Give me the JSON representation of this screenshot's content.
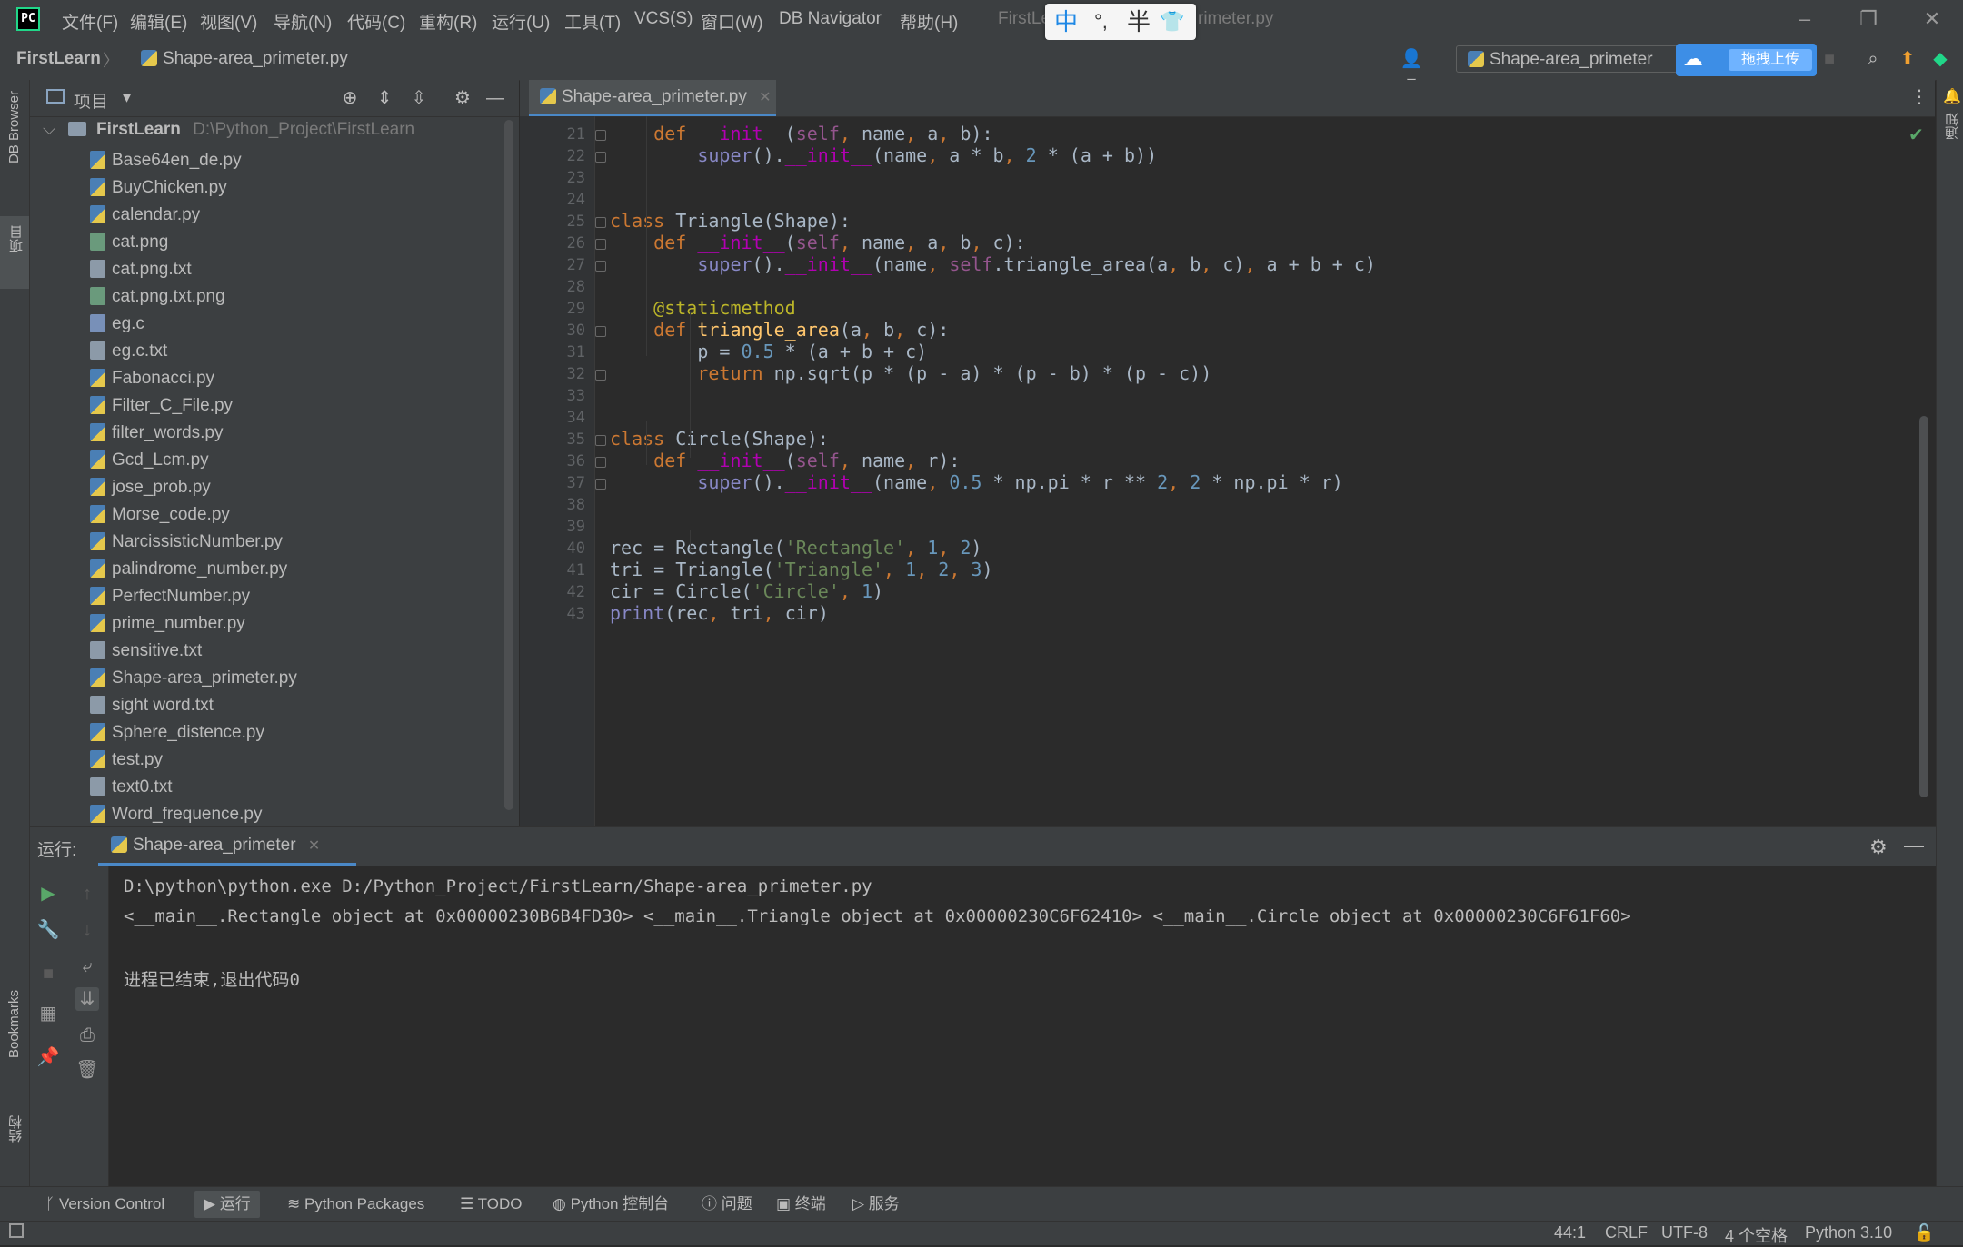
{
  "menu": {
    "items": [
      "文件(F)",
      "编辑(E)",
      "视图(V)",
      "导航(N)",
      "代码(C)",
      "重构(R)",
      "运行(U)",
      "工具(T)",
      "VCS(S)",
      "窗口(W)",
      "DB Navigator",
      "帮助(H)"
    ],
    "window_title_left": "FirstLe",
    "window_title_right": "rimeter.py",
    "ime": {
      "zh": "中",
      "punct": "°,",
      "half": "半",
      "skin": "👕"
    }
  },
  "navbar": {
    "project": "FirstLearn",
    "file": "Shape-area_primeter.py",
    "run_config": "Shape-area_primeter",
    "upload_label": "拖拽上传"
  },
  "left_strip": {
    "db_browser": "DB Browser",
    "project": "项目",
    "bookmarks": "Bookmarks",
    "structure": "结构"
  },
  "right_strip": {
    "notifications": "通知"
  },
  "project_panel": {
    "title": "项目",
    "root_name": "FirstLearn",
    "root_path": "D:\\Python_Project\\FirstLearn",
    "files": [
      {
        "name": "Base64en_de.py",
        "type": "py"
      },
      {
        "name": "BuyChicken.py",
        "type": "py"
      },
      {
        "name": "calendar.py",
        "type": "py"
      },
      {
        "name": "cat.png",
        "type": "png"
      },
      {
        "name": "cat.png.txt",
        "type": "txt"
      },
      {
        "name": "cat.png.txt.png",
        "type": "png"
      },
      {
        "name": "eg.c",
        "type": "c"
      },
      {
        "name": "eg.c.txt",
        "type": "txt"
      },
      {
        "name": "Fabonacci.py",
        "type": "py"
      },
      {
        "name": "Filter_C_File.py",
        "type": "py"
      },
      {
        "name": "filter_words.py",
        "type": "py"
      },
      {
        "name": "Gcd_Lcm.py",
        "type": "py"
      },
      {
        "name": "jose_prob.py",
        "type": "py"
      },
      {
        "name": "Morse_code.py",
        "type": "py"
      },
      {
        "name": "NarcissisticNumber.py",
        "type": "py"
      },
      {
        "name": "palindrome_number.py",
        "type": "py"
      },
      {
        "name": "PerfectNumber.py",
        "type": "py"
      },
      {
        "name": "prime_number.py",
        "type": "py"
      },
      {
        "name": "sensitive.txt",
        "type": "txt"
      },
      {
        "name": "Shape-area_primeter.py",
        "type": "py"
      },
      {
        "name": "sight word.txt",
        "type": "txt"
      },
      {
        "name": "Sphere_distence.py",
        "type": "py"
      },
      {
        "name": "test.py",
        "type": "py"
      },
      {
        "name": "text0.txt",
        "type": "txt"
      },
      {
        "name": "Word_frequence.py",
        "type": "py"
      }
    ]
  },
  "editor": {
    "tab_label": "Shape-area_primeter.py",
    "lines": [
      {
        "no": "21",
        "code": "    def __init__(self, name, a, b):"
      },
      {
        "no": "22",
        "code": "        super().__init__(name, a * b, 2 * (a + b))"
      },
      {
        "no": "23",
        "code": ""
      },
      {
        "no": "24",
        "code": ""
      },
      {
        "no": "25",
        "code": "class Triangle(Shape):"
      },
      {
        "no": "26",
        "code": "    def __init__(self, name, a, b, c):"
      },
      {
        "no": "27",
        "code": "        super().__init__(name, self.triangle_area(a, b, c), a + b + c)"
      },
      {
        "no": "28",
        "code": ""
      },
      {
        "no": "29",
        "code": "    @staticmethod"
      },
      {
        "no": "30",
        "code": "    def triangle_area(a, b, c):"
      },
      {
        "no": "31",
        "code": "        p = 0.5 * (a + b + c)"
      },
      {
        "no": "32",
        "code": "        return np.sqrt(p * (p - a) * (p - b) * (p - c))"
      },
      {
        "no": "33",
        "code": ""
      },
      {
        "no": "34",
        "code": ""
      },
      {
        "no": "35",
        "code": "class Circle(Shape):"
      },
      {
        "no": "36",
        "code": "    def __init__(self, name, r):"
      },
      {
        "no": "37",
        "code": "        super().__init__(name, 0.5 * np.pi * r ** 2, 2 * np.pi * r)"
      },
      {
        "no": "38",
        "code": ""
      },
      {
        "no": "39",
        "code": ""
      },
      {
        "no": "40",
        "code": "rec = Rectangle('Rectangle', 1, 2)"
      },
      {
        "no": "41",
        "code": "tri = Triangle('Triangle', 1, 2, 3)"
      },
      {
        "no": "42",
        "code": "cir = Circle('Circle', 1)"
      },
      {
        "no": "43",
        "code": "print(rec, tri, cir)"
      }
    ]
  },
  "run_panel": {
    "label": "运行:",
    "tab_label": "Shape-area_primeter",
    "output": [
      "D:\\python\\python.exe D:/Python_Project/FirstLearn/Shape-area_primeter.py",
      "<__main__.Rectangle object at 0x00000230B6B4FD30> <__main__.Triangle object at 0x00000230C6F62410> <__main__.Circle object at 0x00000230C6F61F60>",
      "",
      "进程已结束,退出代码0"
    ]
  },
  "tool_windows": [
    "Version Control",
    "运行",
    "Python Packages",
    "TODO",
    "Python 控制台",
    "问题",
    "终端",
    "服务"
  ],
  "status": {
    "position": "44:1",
    "line_sep": "CRLF",
    "encoding": "UTF-8",
    "indent": "4 个空格",
    "interpreter": "Python 3.10"
  }
}
